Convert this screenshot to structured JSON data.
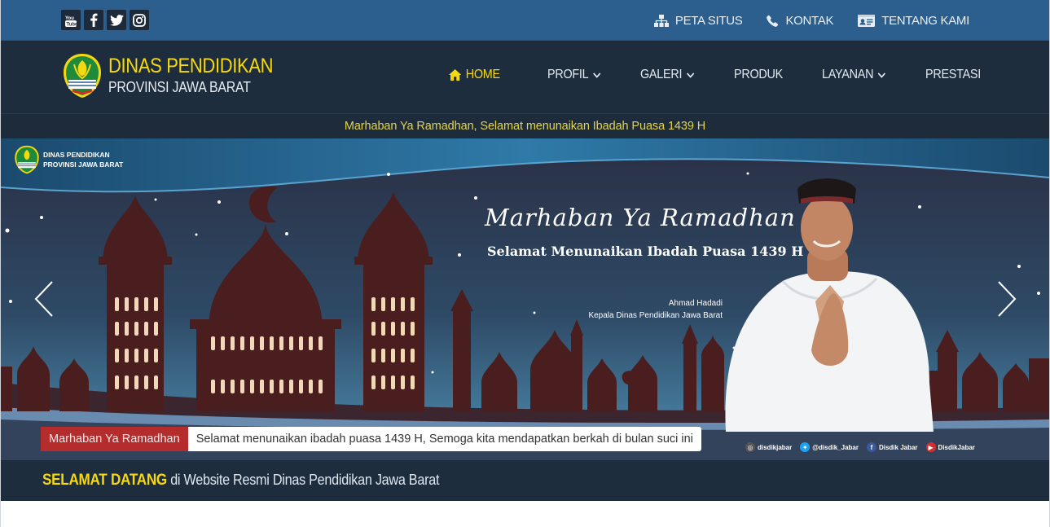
{
  "topbar": {
    "social_icons": [
      "youtube-icon",
      "facebook-icon",
      "twitter-icon",
      "instagram-icon"
    ],
    "links": [
      {
        "label": "PETA SITUS",
        "icon": "sitemap-icon"
      },
      {
        "label": "KONTAK",
        "icon": "phone-icon"
      },
      {
        "label": "TENTANG KAMI",
        "icon": "id-card-icon"
      }
    ]
  },
  "brand": {
    "title": "DINAS PENDIDIKAN",
    "subtitle": "PROVINSI JAWA BARAT"
  },
  "menu": [
    {
      "label": "HOME",
      "active": true,
      "dropdown": false
    },
    {
      "label": "PROFIL",
      "active": false,
      "dropdown": true
    },
    {
      "label": "GALERI",
      "active": false,
      "dropdown": true
    },
    {
      "label": "PRODUK",
      "active": false,
      "dropdown": false
    },
    {
      "label": "LAYANAN",
      "active": false,
      "dropdown": true
    },
    {
      "label": "PRESTASI",
      "active": false,
      "dropdown": false
    }
  ],
  "announcement": "Marhaban Ya Ramadhan, Selamat menunaikan Ibadah Puasa 1439 H",
  "banner": {
    "logo_line1": "DINAS PENDIDIKAN",
    "logo_line2": "PROVINSI JAWA BARAT",
    "script_heading": "Marhaban Ya Ramadhan",
    "subheading": "Selamat Menunaikan Ibadah Puasa 1439 H",
    "person_name": "Ahmad Hadadi",
    "person_title": "Kepala Dinas Pendidikan Jawa Barat",
    "ticker_label": "Marhaban Ya Ramadhan",
    "ticker_text": "Selamat menunaikan ibadah puasa 1439 H, Semoga kita mendapatkan berkah di bulan suci ini",
    "socials": [
      {
        "icon": "instagram-icon",
        "label": "disdikjabar",
        "color": "#555555"
      },
      {
        "icon": "twitter-icon",
        "label": "@disdik_Jabar",
        "color": "#1da1f2"
      },
      {
        "icon": "facebook-icon",
        "label": "Disdik Jabar",
        "color": "#3b5998"
      },
      {
        "icon": "youtube-icon",
        "label": "DisdikJabar",
        "color": "#d32f2f"
      }
    ]
  },
  "welcome": {
    "bold": "SELAMAT DATANG",
    "rest": " di Website Resmi Dinas Pendidikan Jawa Barat"
  },
  "colors": {
    "topbar": "#2c5f8e",
    "navbar": "#1e2d3e",
    "accent_yellow": "#f5d90e",
    "ticker_red": "#b52c2c"
  }
}
